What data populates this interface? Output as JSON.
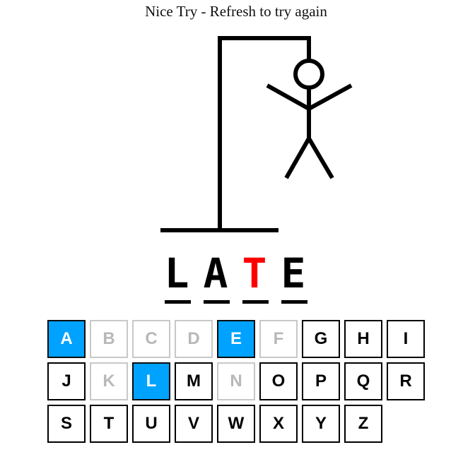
{
  "status_text": "Nice Try - Refresh to try again",
  "word": {
    "letters": [
      {
        "char": "L",
        "state": "guessed"
      },
      {
        "char": "A",
        "state": "guessed"
      },
      {
        "char": "T",
        "state": "revealed"
      },
      {
        "char": "E",
        "state": "guessed"
      }
    ]
  },
  "colors": {
    "guessed_letter": "#000000",
    "revealed_letter": "#ff0000",
    "key_correct_bg": "#00a2ff",
    "key_wrong_text": "#b8b8b8",
    "drawing": "#000000"
  },
  "keyboard": {
    "rows": [
      [
        {
          "label": "A",
          "state": "correct"
        },
        {
          "label": "B",
          "state": "wrong"
        },
        {
          "label": "C",
          "state": "wrong"
        },
        {
          "label": "D",
          "state": "wrong"
        },
        {
          "label": "E",
          "state": "correct"
        },
        {
          "label": "F",
          "state": "wrong"
        },
        {
          "label": "G",
          "state": "unused"
        },
        {
          "label": "H",
          "state": "unused"
        },
        {
          "label": "I",
          "state": "unused"
        }
      ],
      [
        {
          "label": "J",
          "state": "unused"
        },
        {
          "label": "K",
          "state": "wrong"
        },
        {
          "label": "L",
          "state": "correct"
        },
        {
          "label": "M",
          "state": "unused"
        },
        {
          "label": "N",
          "state": "wrong"
        },
        {
          "label": "O",
          "state": "unused"
        },
        {
          "label": "P",
          "state": "unused"
        },
        {
          "label": "Q",
          "state": "unused"
        },
        {
          "label": "R",
          "state": "unused"
        }
      ],
      [
        {
          "label": "S",
          "state": "unused"
        },
        {
          "label": "T",
          "state": "unused"
        },
        {
          "label": "U",
          "state": "unused"
        },
        {
          "label": "V",
          "state": "unused"
        },
        {
          "label": "W",
          "state": "unused"
        },
        {
          "label": "X",
          "state": "unused"
        },
        {
          "label": "Y",
          "state": "unused"
        },
        {
          "label": "Z",
          "state": "unused"
        }
      ]
    ]
  },
  "hangman": {
    "parts_drawn": [
      "gallows-base",
      "gallows-pole",
      "gallows-beam",
      "rope",
      "head",
      "body",
      "left-arm",
      "right-arm",
      "left-leg",
      "right-leg"
    ]
  }
}
